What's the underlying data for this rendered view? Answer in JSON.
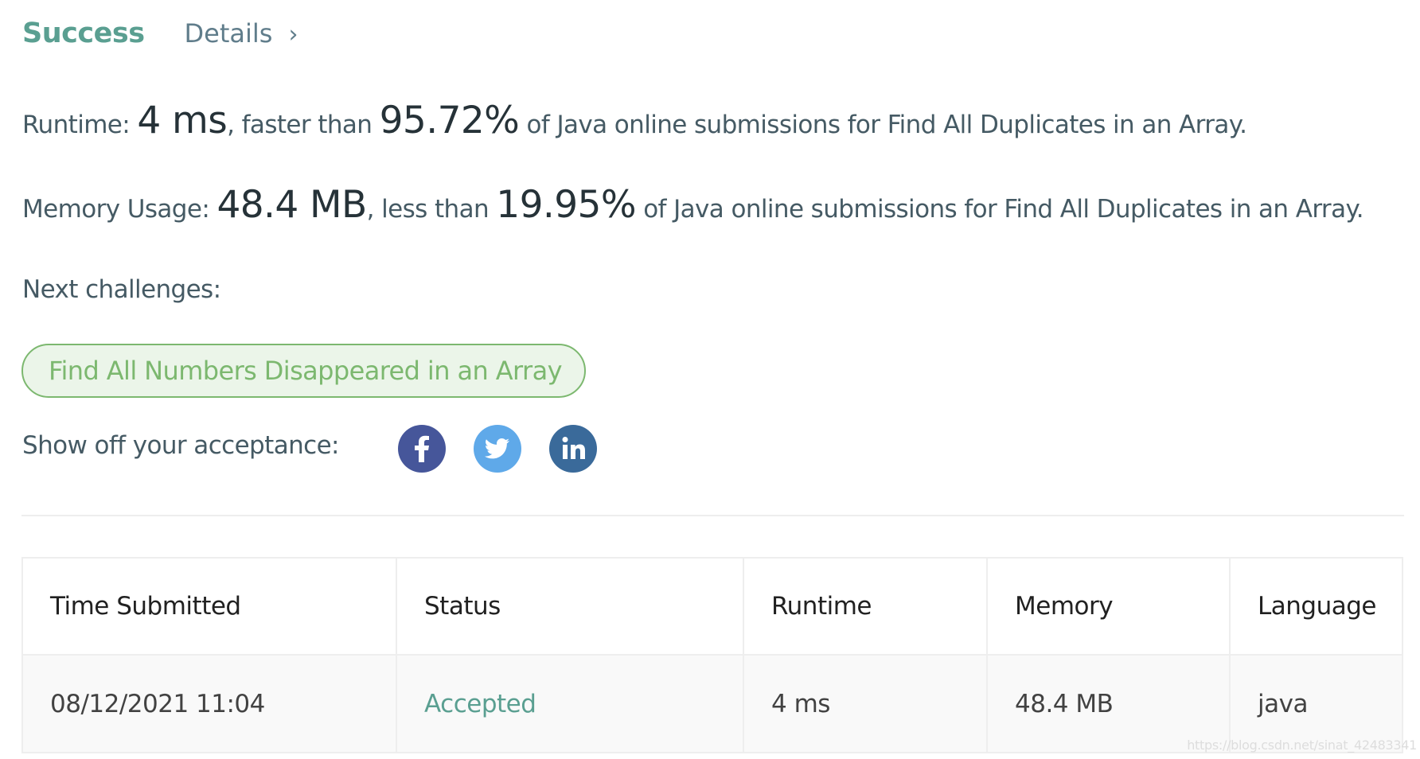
{
  "header": {
    "status": "Success",
    "details_label": "Details",
    "details_icon": "chevron-right-icon"
  },
  "runtime": {
    "label": "Runtime:",
    "value": "4 ms",
    "comparison": ", faster than",
    "percent": "95.72%",
    "suffix": "of Java online submissions for Find All Duplicates in an Array."
  },
  "memory": {
    "label": "Memory Usage:",
    "value": "48.4 MB",
    "comparison": ", less than",
    "percent": "19.95%",
    "suffix": "of Java online submissions for Find All Duplicates in an Array."
  },
  "next": {
    "label": "Next challenges:",
    "challenges": [
      "Find All Numbers Disappeared in an Array"
    ]
  },
  "share": {
    "label": "Show off your acceptance:",
    "icons": [
      {
        "name": "facebook-icon",
        "glyph": "f",
        "color": "#46569a"
      },
      {
        "name": "twitter-icon",
        "glyph": "bird",
        "color": "#5fa9e9"
      },
      {
        "name": "linkedin-icon",
        "glyph": "in",
        "color": "#3a6a9a"
      }
    ]
  },
  "table": {
    "columns": [
      "Time Submitted",
      "Status",
      "Runtime",
      "Memory",
      "Language"
    ],
    "rows": [
      [
        "08/12/2021 11:04",
        "Accepted",
        "4 ms",
        "48.4 MB",
        "java"
      ]
    ]
  },
  "watermark": "https://blog.csdn.net/sinat_42483341",
  "colors": {
    "success": "#5a9f91",
    "challenge_green": "#7cb86f",
    "accepted": "#5a9f91"
  }
}
